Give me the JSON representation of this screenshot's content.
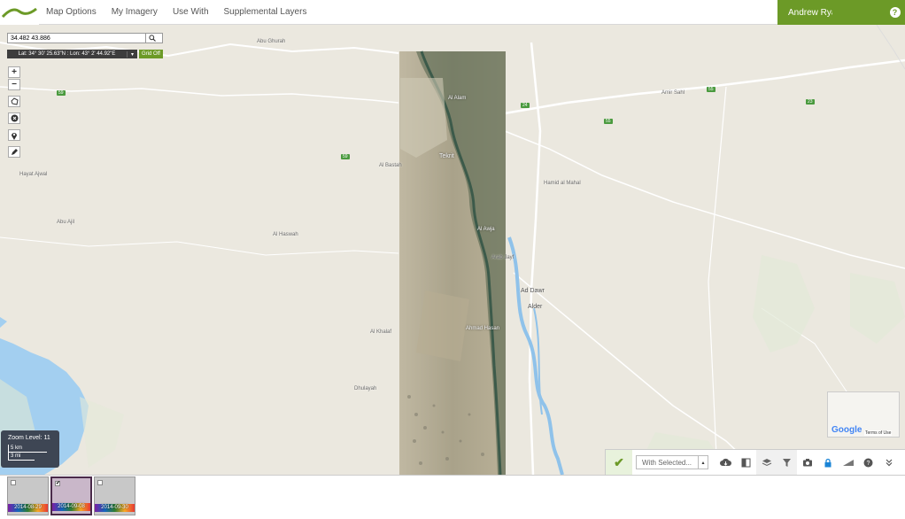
{
  "topbar": {
    "menu": [
      "Map Options",
      "My Imagery",
      "Use With",
      "Supplemental Layers"
    ],
    "user": "Andrew Ryan"
  },
  "search": {
    "value": "34.482 43.886"
  },
  "coords": {
    "text": "Lat: 34° 30' 25.63\"N : Lon: 43° 2' 44.92\"E",
    "grid_label": "Grid Off"
  },
  "scale": {
    "zoom_label": "Zoom Level: 11",
    "km": "5 km",
    "mi": "3 mi"
  },
  "minimap": {
    "terms": "Terms of Use",
    "google": "Google"
  },
  "toolbar": {
    "with_selected": "With Selected..."
  },
  "thumbnails": [
    {
      "date": "2014-08-29",
      "selected": false
    },
    {
      "date": "2014-09-08",
      "selected": true
    },
    {
      "date": "2014-09-30",
      "selected": false
    }
  ],
  "places": [
    {
      "t": "Tekrit",
      "c": "light big"
    },
    {
      "t": "Al Alam",
      "c": "light"
    },
    {
      "t": "Ad Dawr",
      "c": "big"
    },
    {
      "t": "Alder",
      "c": "big"
    },
    {
      "t": "Al Awja",
      "c": "light"
    },
    {
      "t": "Arab Jayf",
      "c": ""
    },
    {
      "t": "Al Bastah",
      "c": ""
    },
    {
      "t": "Abu Ajil",
      "c": ""
    },
    {
      "t": "Ahmad Hasan",
      "c": "light"
    },
    {
      "t": "Al Khalaf",
      "c": ""
    },
    {
      "t": "Abu Ghurah",
      "c": ""
    },
    {
      "t": "Al Haswah",
      "c": ""
    },
    {
      "t": "Amir Sahl",
      "c": ""
    },
    {
      "t": "Hamid al Mahal",
      "c": ""
    },
    {
      "t": "Hayat Ajwal",
      "c": ""
    },
    {
      "t": "Dhulayah",
      "c": ""
    }
  ],
  "colors": {
    "brand": "#6c9a27",
    "water": "#a3cff0",
    "road": "#ffffff"
  }
}
